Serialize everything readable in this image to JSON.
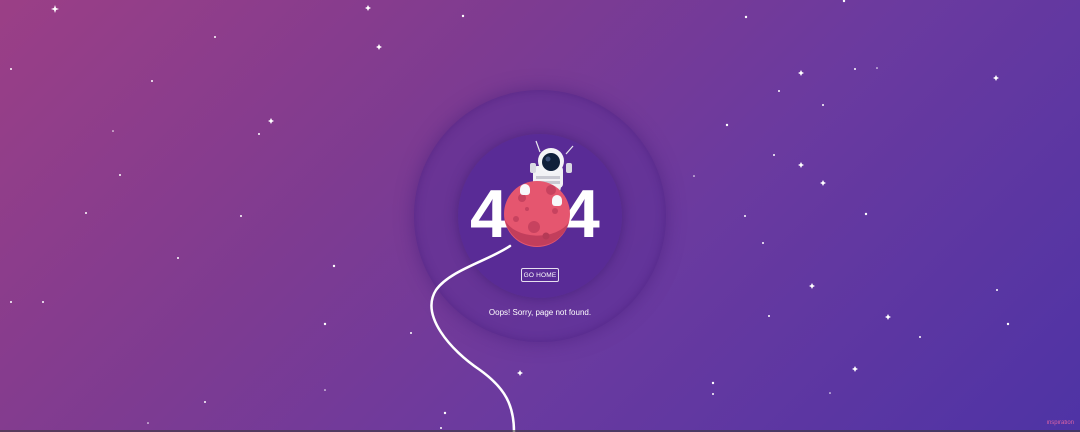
{
  "error": {
    "code_left": "4",
    "code_right": "4",
    "button_label": "GO HOME",
    "message": "Oops! Sorry, page not found."
  },
  "footer": {
    "credit": "inspiration"
  },
  "colors": {
    "background_start": "#9b3f86",
    "background_end": "#4e33a5",
    "planet": "#e4546f",
    "text": "#ffffff"
  },
  "icons": [
    "star-icon",
    "astronaut-icon",
    "planet-icon"
  ]
}
